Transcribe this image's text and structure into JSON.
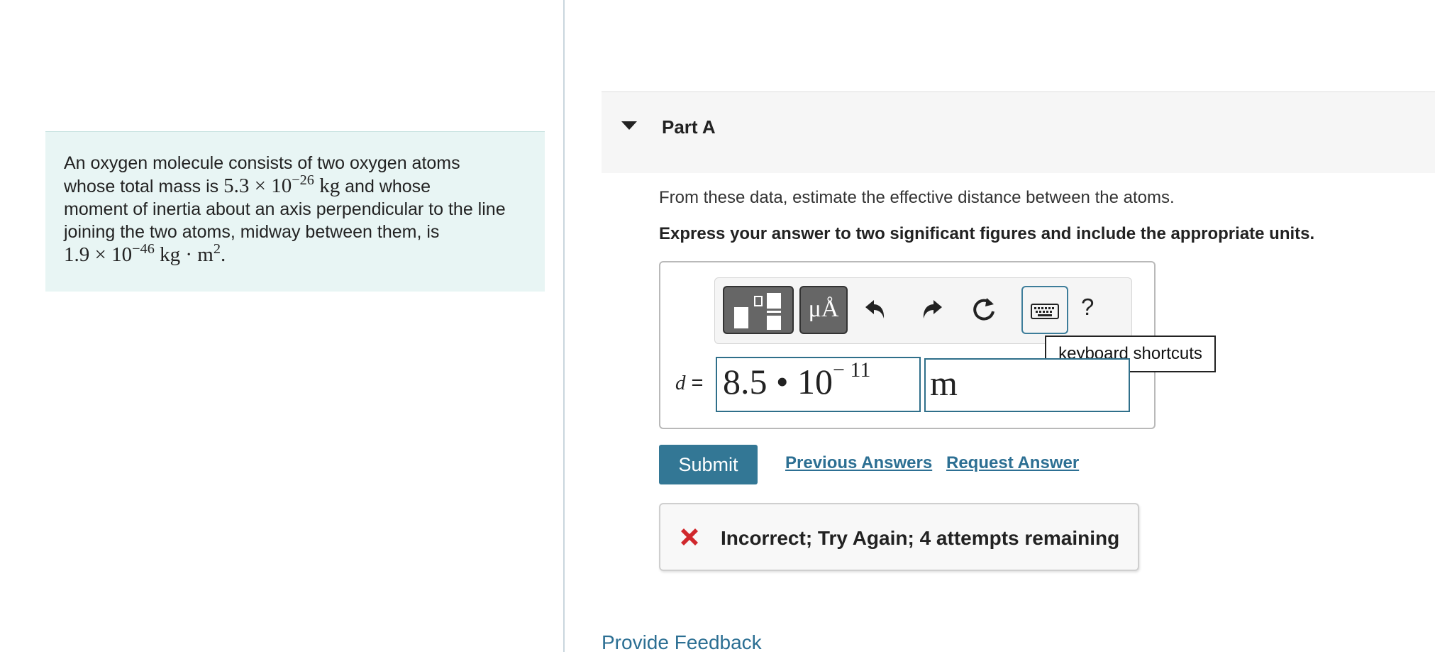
{
  "problem": {
    "line1": "An oxygen molecule consists of two oxygen atoms",
    "line2_prefix": "whose total mass is ",
    "mass_mantissa": "5.3 × 10",
    "mass_exponent": "−26",
    "mass_unit": " kg",
    "line2_suffix": " and whose",
    "line3": "moment of inertia about an axis perpendicular to the line",
    "line4": "joining the two atoms, midway between them, is",
    "inertia_mantissa": "1.9 × 10",
    "inertia_exponent": "−46",
    "inertia_unit": " kg · m",
    "inertia_unit_exponent": "2",
    "inertia_end": "."
  },
  "part": {
    "title": "Part A",
    "prompt": "From these data, estimate the effective distance between the atoms.",
    "instruction": "Express your answer to two significant figures and include the appropriate units."
  },
  "toolbar": {
    "units_label": "μÅ",
    "help_label": "?",
    "tooltip": "keyboard shortcuts",
    "icons": [
      "templates-icon",
      "units-icon",
      "undo-icon",
      "redo-icon",
      "reset-icon",
      "keyboard-icon",
      "help-icon"
    ]
  },
  "answer": {
    "variable": "d",
    "equals": " =",
    "value_mantissa": "8.5 • 10",
    "value_exponent": "− 11",
    "unit": "m"
  },
  "actions": {
    "submit": "Submit",
    "previous_answers": "Previous Answers",
    "request_answer": "Request Answer"
  },
  "feedback": {
    "message": "Incorrect; Try Again; 4 attempts remaining",
    "status_color": "#d0282d"
  },
  "footer": {
    "provide_feedback": "Provide Feedback"
  },
  "colors": {
    "accent": "#337795",
    "link": "#2c6f93",
    "problem_bg": "#e8f5f4"
  }
}
